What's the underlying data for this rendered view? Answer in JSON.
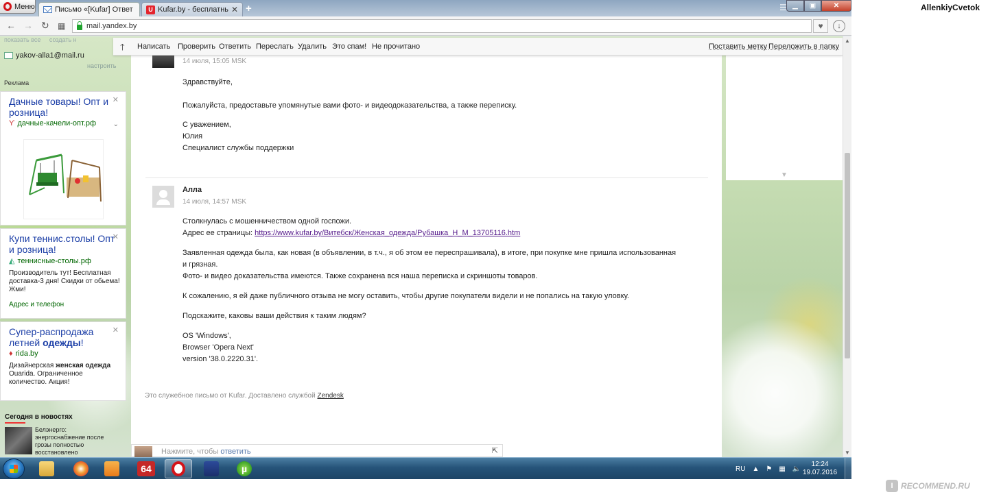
{
  "browser": {
    "menu_label": "Меню",
    "tabs": [
      {
        "title": "Письмо «[Kufar] Ответ на",
        "active": true
      },
      {
        "title": "Kufar.by - бесплатные об",
        "active": false
      }
    ],
    "new_tab": "+",
    "url": "mail.yandex.by"
  },
  "left": {
    "ghost_links": [
      "показать все",
      "создать н"
    ],
    "account_email": "yakov-alla1@mail.ru",
    "setup_link": "настроить",
    "ads_label": "Реклама",
    "ads": [
      {
        "title_parts": [
          "Дачные товары! Опт и розница!"
        ],
        "domain": "дачные-качели-опт.рф"
      },
      {
        "title": "Купи теннис.столы! Опт и розница!",
        "domain": "теннисные-столы.рф",
        "text": "Производитель тут! Бесплатная доставка-3 дня! Скидки от обьема! Жми!",
        "sub": "Адрес и телефон"
      },
      {
        "title_prefix": "Супер-распродажа летней ",
        "title_bold": "одежды",
        "title_suffix": "!",
        "domain": "rida.by",
        "text_prefix": "Дизайнерская ",
        "text_bold": "женская одежда",
        "text_suffix": " Ouarida. Ограниченное количество. Акция!"
      }
    ],
    "news_title": "Сегодня в новостях",
    "news_item": "Белэнерго: энергоснабжение после грозы полностью восстановлено"
  },
  "toolbar": {
    "items": [
      "Написать",
      "Проверить",
      "Ответить",
      "Переслать",
      "Удалить",
      "Это спам!",
      "Не прочитано"
    ],
    "right_items": [
      "Поставить метку",
      "Переложить в папку"
    ]
  },
  "messages": [
    {
      "date": "14 июля, 15:05 MSK",
      "lines": [
        "Здравствуйте,",
        "Пожалуйста, предоставьте упомянутые вами фото- и видеодоказательства, а также переписку.",
        "С уважением,",
        "Юлия",
        "Специалист службы поддержки"
      ]
    },
    {
      "sender": "Алла",
      "date": "14 июля, 14:57 MSK",
      "p1": "Столкнулась с мошенничеством одной госпожи.",
      "address_label": "Адрес ее страницы: ",
      "address_link": "https://www.kufar.by/Витебск/Женская_одежда/Рубашка_H_M_13705116.htm",
      "p2a": "Заявленная одежда была, как новая (в объявлении, в т.ч., я об этом ее переспрашивала), в итоге, при покупке мне пришла использованная",
      "p2b": "и грязная.",
      "p2c": "Фото- и видео доказательства имеются. Также сохранена вся наша переписка и скриншоты товаров.",
      "p3": "К сожалению, я ей даже публичного отзыва не могу оставить, чтобы другие покупатели видели и не попались на такую уловку.",
      "p4": "Подскажите, каковы ваши действия к таким людям?",
      "os": "OS 'Windows',",
      "browser": "Browser 'Opera Next'",
      "version": "version '38.0.2220.31'."
    }
  ],
  "footer": {
    "note": "Это служебное письмо от Kufar. Доставлено службой ",
    "link": "Zendesk"
  },
  "reply": {
    "placeholder": "Нажмите, чтобы ",
    "action": "ответить"
  },
  "taskbar": {
    "apps": [
      "folder",
      "internet-explorer",
      "media-player",
      "64",
      "opera",
      "save",
      "utorrent"
    ],
    "lang": "RU",
    "time": "12:24",
    "date": "19.07.2016"
  },
  "overlay": {
    "username": "AllenkiyCvetok",
    "site": "RECOMMEND.RU"
  }
}
